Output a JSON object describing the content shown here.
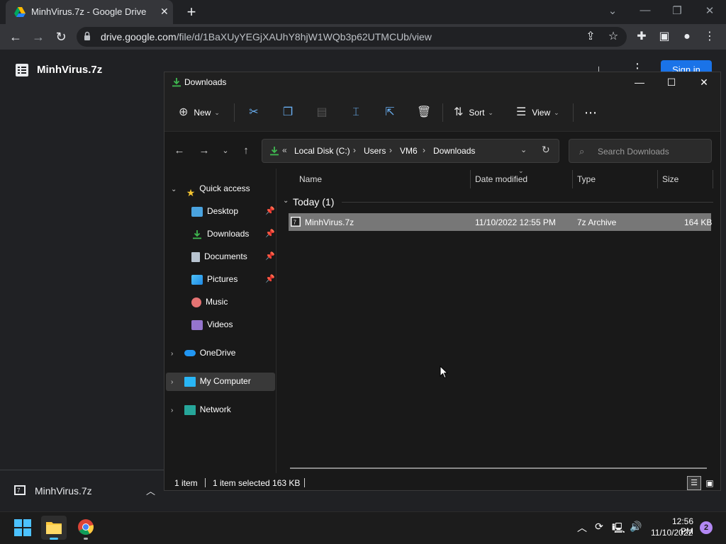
{
  "browser": {
    "tab_title": "MinhVirus.7z - Google Drive",
    "new_tab": "+",
    "url_host": "drive.google.com",
    "url_path": "/file/d/1BaXUyYEGjXAUhY8hjW1WQb3p62UTMCUb/view"
  },
  "drive": {
    "file_title": "MinhVirus.7z",
    "sign_in": "Sign in"
  },
  "download_bar": {
    "file_name": "MinhVirus.7z"
  },
  "explorer": {
    "title": "Downloads",
    "commands": {
      "new": "New",
      "sort": "Sort",
      "view": "View"
    },
    "address": {
      "prefix": "«",
      "crumbs": [
        "Local Disk (C:)",
        "Users",
        "VM6",
        "Downloads"
      ]
    },
    "search_placeholder": "Search Downloads",
    "nav": {
      "quick_access": "Quick access",
      "items": [
        "Desktop",
        "Downloads",
        "Documents",
        "Pictures",
        "Music",
        "Videos"
      ],
      "onedrive": "OneDrive",
      "my_computer": "My Computer",
      "network": "Network"
    },
    "columns": {
      "name": "Name",
      "date": "Date modified",
      "type": "Type",
      "size": "Size"
    },
    "group": "Today (1)",
    "file": {
      "name": "MinhVirus.7z",
      "date": "11/10/2022 12:55 PM",
      "type": "7z Archive",
      "size": "164 KB"
    },
    "status": {
      "count": "1 item",
      "selected": "1 item selected  163 KB"
    }
  },
  "taskbar": {
    "time": "12:56 PM",
    "date": "11/10/2022",
    "notifications": "2"
  },
  "colors": {
    "accent_blue": "#1a73e8",
    "download_green": "#3fb950",
    "selection_gray": "#777777"
  }
}
